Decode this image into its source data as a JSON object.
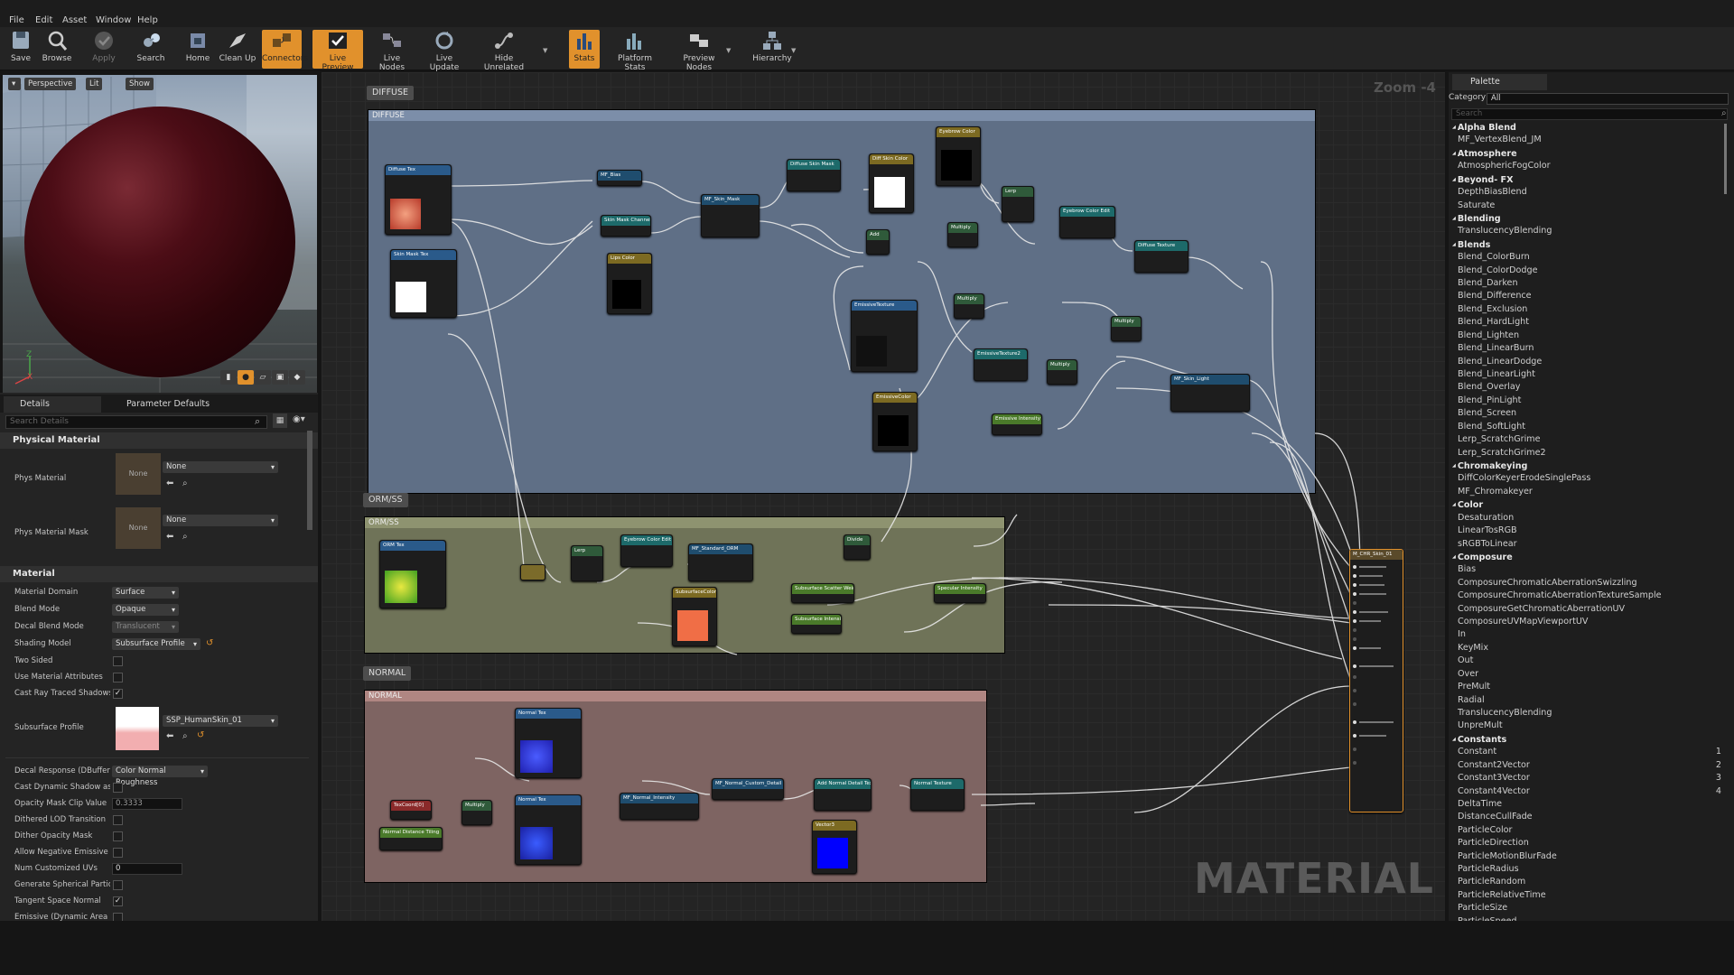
{
  "menu": [
    "File",
    "Edit",
    "Asset",
    "Window",
    "Help"
  ],
  "toolbar": [
    {
      "label": "Save",
      "icon": "save-icon"
    },
    {
      "label": "Browse",
      "icon": "browse-icon"
    },
    {
      "label": "Apply",
      "icon": "apply-icon"
    },
    {
      "label": "Search",
      "icon": "search-icon"
    },
    {
      "label": "Home",
      "icon": "home-icon"
    },
    {
      "label": "Clean Up",
      "icon": "clean-up-icon"
    },
    {
      "label": "Connectors",
      "icon": "connectors-icon"
    },
    {
      "label": "Live Preview",
      "icon": "live-preview-icon"
    },
    {
      "label": "Live Nodes",
      "icon": "live-nodes-icon"
    },
    {
      "label": "Live Update",
      "icon": "live-update-icon"
    },
    {
      "label": "Hide Unrelated",
      "icon": "hide-unrelated-icon"
    },
    {
      "label": "Stats",
      "icon": "stats-icon"
    },
    {
      "label": "Platform Stats",
      "icon": "platform-stats-icon"
    },
    {
      "label": "Preview Nodes",
      "icon": "preview-nodes-icon"
    },
    {
      "label": "Hierarchy",
      "icon": "hierarchy-icon"
    }
  ],
  "viewport": {
    "perspective": "Perspective",
    "lit": "Lit",
    "show": "Show",
    "axis_z": "Z",
    "axis_x": "X"
  },
  "details": {
    "tab_details": "Details",
    "tab_params": "Parameter Defaults",
    "search_placeholder": "Search Details",
    "physical_material": {
      "header": "Physical Material",
      "phys_material_label": "Phys Material",
      "phys_material_value": "None",
      "phys_material_thumb": "None",
      "phys_material_mask_label": "Phys Material Mask",
      "phys_material_mask_value": "None",
      "phys_material_mask_thumb": "None"
    },
    "material": {
      "header": "Material",
      "rows": [
        {
          "label": "Material Domain",
          "value": "Surface"
        },
        {
          "label": "Blend Mode",
          "value": "Opaque"
        },
        {
          "label": "Decal Blend Mode",
          "value": "Translucent"
        },
        {
          "label": "Shading Model",
          "value": "Subsurface Profile"
        },
        {
          "label": "Two Sided",
          "checked": false
        },
        {
          "label": "Use Material Attributes",
          "checked": false
        },
        {
          "label": "Cast Ray Traced Shadows",
          "checked": true
        }
      ],
      "subsurface_label": "Subsurface Profile",
      "subsurface_value": "SSP_HumanSkin_01",
      "rows2": [
        {
          "label": "Decal Response (DBuffer)",
          "value": "Color Normal Roughness"
        },
        {
          "label": "Cast Dynamic Shadow as Ma",
          "checked": false
        },
        {
          "label": "Opacity Mask Clip Value",
          "value": "0.3333"
        },
        {
          "label": "Dithered LOD Transition",
          "checked": false
        },
        {
          "label": "Dither Opacity Mask",
          "checked": false
        },
        {
          "label": "Allow Negative Emissive Colo",
          "checked": false
        },
        {
          "label": "Num Customized UVs",
          "value": "0"
        },
        {
          "label": "Generate Spherical Particle N",
          "checked": false
        },
        {
          "label": "Tangent Space Normal",
          "checked": true
        },
        {
          "label": "Emissive (Dynamic Area Ligh",
          "checked": false
        }
      ]
    }
  },
  "graph": {
    "zoom": "Zoom -4",
    "watermark": "MATERIAL",
    "comments": [
      {
        "tag": "DIFFUSE",
        "title": "DIFFUSE"
      },
      {
        "tag": "ORM/SS",
        "title": "ORM/SS"
      },
      {
        "tag": "NORMAL",
        "title": "NORMAL"
      }
    ],
    "nodes": [
      "Diffuse Tex",
      "Skin Mask Tex",
      "MF_Bias",
      "Skin Mask Channel",
      "MF_Skin_Mask",
      "Lips Color",
      "Diffuse Skin Mask",
      "Diff Skin Color",
      "Eyebrow Color",
      "Add",
      "Multiply",
      "Lerp",
      "Eyebrow Color Edit",
      "Diffuse Texture",
      "EmissiveTexture",
      "Multiply",
      "EmissiveTexture2",
      "Multiply",
      "Multiply",
      "MF_Skin_Light",
      "EmissiveColor",
      "Emissive Intensity",
      "ORM Tex",
      "Lerp",
      "Eyebrow Color Edit",
      "MF_Standard_ORM",
      "Divide",
      "SubsurfaceColor",
      "Subsurface Scatter Weight",
      "Specular Intensity",
      "Subsurface Intensity",
      "M_CHR_Skin_01",
      "Normal Tex",
      "TexCoord[0]",
      "Multiply",
      "Normal Distance Tiling",
      "Normal Tex",
      "MF_Normal_Intensity",
      "MF_Normal_Custom_Detail",
      "Add Normal Detail Tex",
      "Normal Texture",
      "Vector3"
    ]
  },
  "palette": {
    "tab": "Palette",
    "category_label": "Category",
    "category_value": "All",
    "search_placeholder": "Search",
    "items": [
      {
        "t": "Alpha Blend",
        "cat": true
      },
      {
        "t": "MF_VertexBlend_JM"
      },
      {
        "t": "Atmosphere",
        "cat": true
      },
      {
        "t": "AtmosphericFogColor"
      },
      {
        "t": "Beyond- FX",
        "cat": true
      },
      {
        "t": "DepthBiasBlend"
      },
      {
        "t": "Saturate"
      },
      {
        "t": "Blending",
        "cat": true
      },
      {
        "t": "TranslucencyBlending"
      },
      {
        "t": "Blends",
        "cat": true
      },
      {
        "t": "Blend_ColorBurn"
      },
      {
        "t": "Blend_ColorDodge"
      },
      {
        "t": "Blend_Darken"
      },
      {
        "t": "Blend_Difference"
      },
      {
        "t": "Blend_Exclusion"
      },
      {
        "t": "Blend_HardLight"
      },
      {
        "t": "Blend_Lighten"
      },
      {
        "t": "Blend_LinearBurn"
      },
      {
        "t": "Blend_LinearDodge"
      },
      {
        "t": "Blend_LinearLight"
      },
      {
        "t": "Blend_Overlay"
      },
      {
        "t": "Blend_PinLight"
      },
      {
        "t": "Blend_Screen"
      },
      {
        "t": "Blend_SoftLight"
      },
      {
        "t": "Lerp_ScratchGrime"
      },
      {
        "t": "Lerp_ScratchGrime2"
      },
      {
        "t": "Chromakeying",
        "cat": true
      },
      {
        "t": "DiffColorKeyerErodeSinglePass"
      },
      {
        "t": "MF_Chromakeyer"
      },
      {
        "t": "Color",
        "cat": true
      },
      {
        "t": "Desaturation"
      },
      {
        "t": "LinearTosRGB"
      },
      {
        "t": "sRGBToLinear"
      },
      {
        "t": "Composure",
        "cat": true
      },
      {
        "t": "Bias"
      },
      {
        "t": "ComposureChromaticAberrationSwizzling"
      },
      {
        "t": "ComposureChromaticAberrationTextureSample"
      },
      {
        "t": "ComposureGetChromaticAberrationUV"
      },
      {
        "t": "ComposureUVMapViewportUV"
      },
      {
        "t": "In"
      },
      {
        "t": "KeyMix"
      },
      {
        "t": "Out"
      },
      {
        "t": "Over"
      },
      {
        "t": "PreMult"
      },
      {
        "t": "Radial"
      },
      {
        "t": "TranslucencyBlending"
      },
      {
        "t": "UnpreMult"
      },
      {
        "t": "Constants",
        "cat": true
      },
      {
        "t": "Constant",
        "n": "1"
      },
      {
        "t": "Constant2Vector",
        "n": "2"
      },
      {
        "t": "Constant3Vector",
        "n": "3"
      },
      {
        "t": "Constant4Vector",
        "n": "4"
      },
      {
        "t": "DeltaTime"
      },
      {
        "t": "DistanceCullFade"
      },
      {
        "t": "ParticleColor"
      },
      {
        "t": "ParticleDirection"
      },
      {
        "t": "ParticleMotionBlurFade"
      },
      {
        "t": "ParticleRadius"
      },
      {
        "t": "ParticleRandom"
      },
      {
        "t": "ParticleRelativeTime"
      },
      {
        "t": "ParticleSize"
      },
      {
        "t": "ParticleSpeed"
      }
    ]
  },
  "colors": {
    "accent": "#e1912c",
    "diffuse_comment": "#5f6f86",
    "orm_comment": "#6f7358",
    "normal_comment": "#7e6462"
  }
}
